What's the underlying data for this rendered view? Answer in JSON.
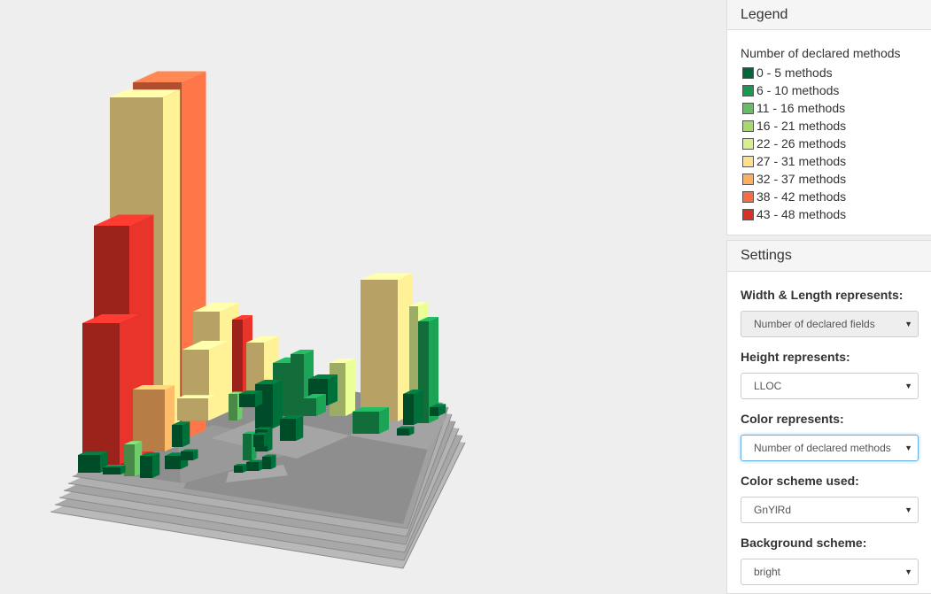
{
  "legend": {
    "heading": "Legend",
    "title": "Number of declared methods",
    "items": [
      {
        "label": "0 - 5 methods",
        "color": "#006837"
      },
      {
        "label": "6 - 10 methods",
        "color": "#1a9850"
      },
      {
        "label": "11 - 16 methods",
        "color": "#66bd63"
      },
      {
        "label": "16 - 21 methods",
        "color": "#a6d96a"
      },
      {
        "label": "22 - 26 methods",
        "color": "#d9ef8b"
      },
      {
        "label": "27 - 31 methods",
        "color": "#fee08b"
      },
      {
        "label": "32 - 37 methods",
        "color": "#fdae61"
      },
      {
        "label": "38 - 42 methods",
        "color": "#f46d43"
      },
      {
        "label": "43 - 48 methods",
        "color": "#d73027"
      }
    ]
  },
  "settings": {
    "heading": "Settings",
    "width_length": {
      "label": "Width & Length represents:",
      "value": "Number of declared fields"
    },
    "height": {
      "label": "Height represents:",
      "value": "LLOC"
    },
    "color": {
      "label": "Color represents:",
      "value": "Number of declared methods"
    },
    "scheme": {
      "label": "Color scheme used:",
      "value": "GnYlRd"
    },
    "background": {
      "label": "Background scheme:",
      "value": "bright"
    }
  },
  "icons": {
    "dropdown": "chevron-down-icon"
  }
}
